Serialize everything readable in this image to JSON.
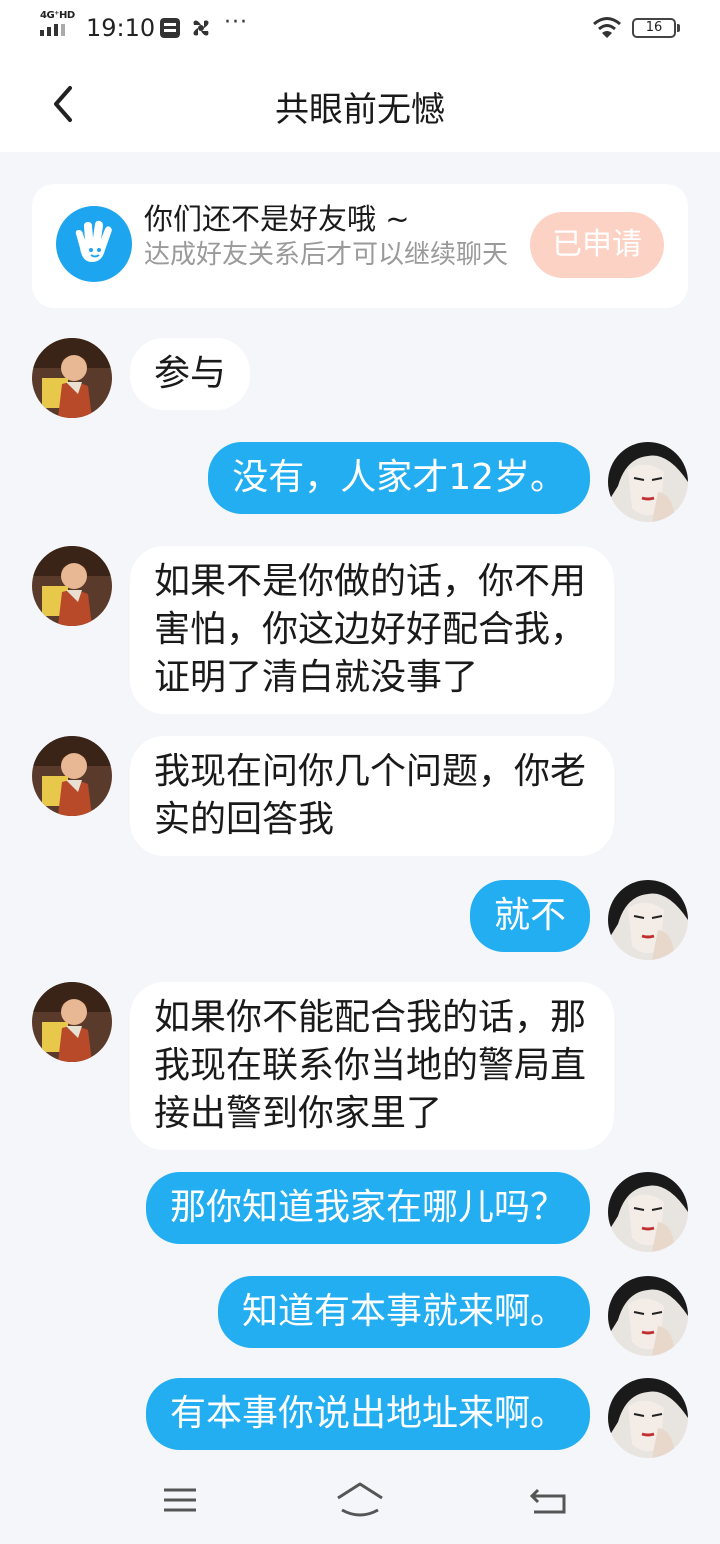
{
  "status_bar": {
    "network": "4G⁺HD",
    "time": "19:10",
    "dots": "···",
    "battery": "16"
  },
  "header": {
    "title": "共眼前无憾"
  },
  "notice": {
    "title": "你们还不是好友哦 ~",
    "subtitle": "达成好友关系后才可以继续聊天",
    "button": "已申请"
  },
  "messages": [
    {
      "side": "left",
      "text": "参与"
    },
    {
      "side": "right",
      "text": "没有，人家才12岁。"
    },
    {
      "side": "left",
      "text": "如果不是你做的话，你不用害怕，你这边好好配合我，证明了清白就没事了"
    },
    {
      "side": "left",
      "text": "我现在问你几个问题，你老实的回答我"
    },
    {
      "side": "right",
      "text": "就不"
    },
    {
      "side": "left",
      "text": "如果你不能配合我的话，那我现在联系你当地的警局直接出警到你家里了"
    },
    {
      "side": "right",
      "text": "那你知道我家在哪儿吗？"
    },
    {
      "side": "right",
      "text": "知道有本事就来啊。"
    },
    {
      "side": "right",
      "text": "有本事你说出地址来啊。"
    }
  ],
  "icons": {
    "back": "back-arrow-icon",
    "notice": "hand-wave-icon",
    "nav_menu": "menu-icon",
    "nav_home": "home-icon",
    "nav_back": "return-icon"
  },
  "colors": {
    "accent": "#23aef2",
    "background": "#f4f6f9",
    "applied_button": "#fcd2c4"
  }
}
